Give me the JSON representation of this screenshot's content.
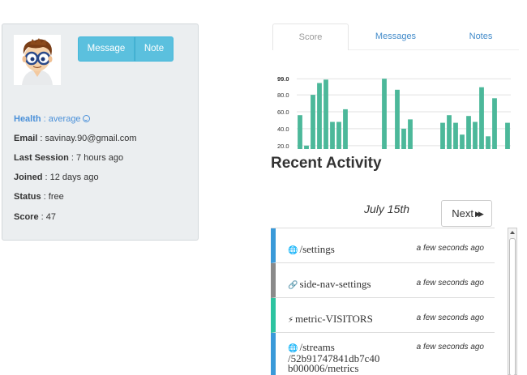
{
  "profile": {
    "buttons": {
      "message": "Message",
      "note": "Note"
    },
    "fields": [
      {
        "label": "Health",
        "value": "average"
      },
      {
        "label": "Email",
        "value": "savinay.90@gmail.com"
      },
      {
        "label": "Last Session",
        "value": "7 hours ago"
      },
      {
        "label": "Joined",
        "value": "12 days ago"
      },
      {
        "label": "Status",
        "value": "free"
      },
      {
        "label": "Score",
        "value": "47"
      }
    ],
    "separator": " : "
  },
  "tabs": {
    "score": "Score",
    "messages": "Messages",
    "notes": "Notes"
  },
  "chart_data": {
    "type": "bar",
    "color": "#4cb89a",
    "ytick_labels": [
      "99.0",
      "80.0",
      "60.0",
      "40.0",
      "20.0"
    ],
    "yticks": [
      99,
      80,
      60,
      40,
      20
    ],
    "ylim": [
      16,
      104
    ],
    "values": [
      56,
      20,
      80,
      94,
      98,
      48,
      48,
      63,
      0,
      0,
      0,
      0,
      0,
      99,
      0,
      86,
      40,
      51,
      0,
      0,
      0,
      0,
      47,
      56,
      47,
      33,
      55,
      48,
      89,
      31,
      76,
      0,
      47
    ]
  },
  "activity": {
    "title": "Recent Activity",
    "date": "July 15th",
    "next_label": "Next",
    "items": [
      {
        "icon": "globe-icon",
        "glyph": "🌐",
        "path": "/settings",
        "time": "a few seconds ago",
        "color": "blue"
      },
      {
        "icon": "link-icon",
        "glyph": "🔗",
        "path": "side-nav-settings",
        "time": "a few seconds ago",
        "color": "gray"
      },
      {
        "icon": "bolt-icon",
        "glyph": "⚡",
        "path": "metric-VISITORS",
        "time": "a few seconds ago",
        "color": "green"
      },
      {
        "icon": "globe-icon",
        "glyph": "🌐",
        "path": "/streams /52b91747841db7c40 b000006/metrics",
        "time": "a few seconds ago",
        "color": "blue"
      }
    ]
  }
}
